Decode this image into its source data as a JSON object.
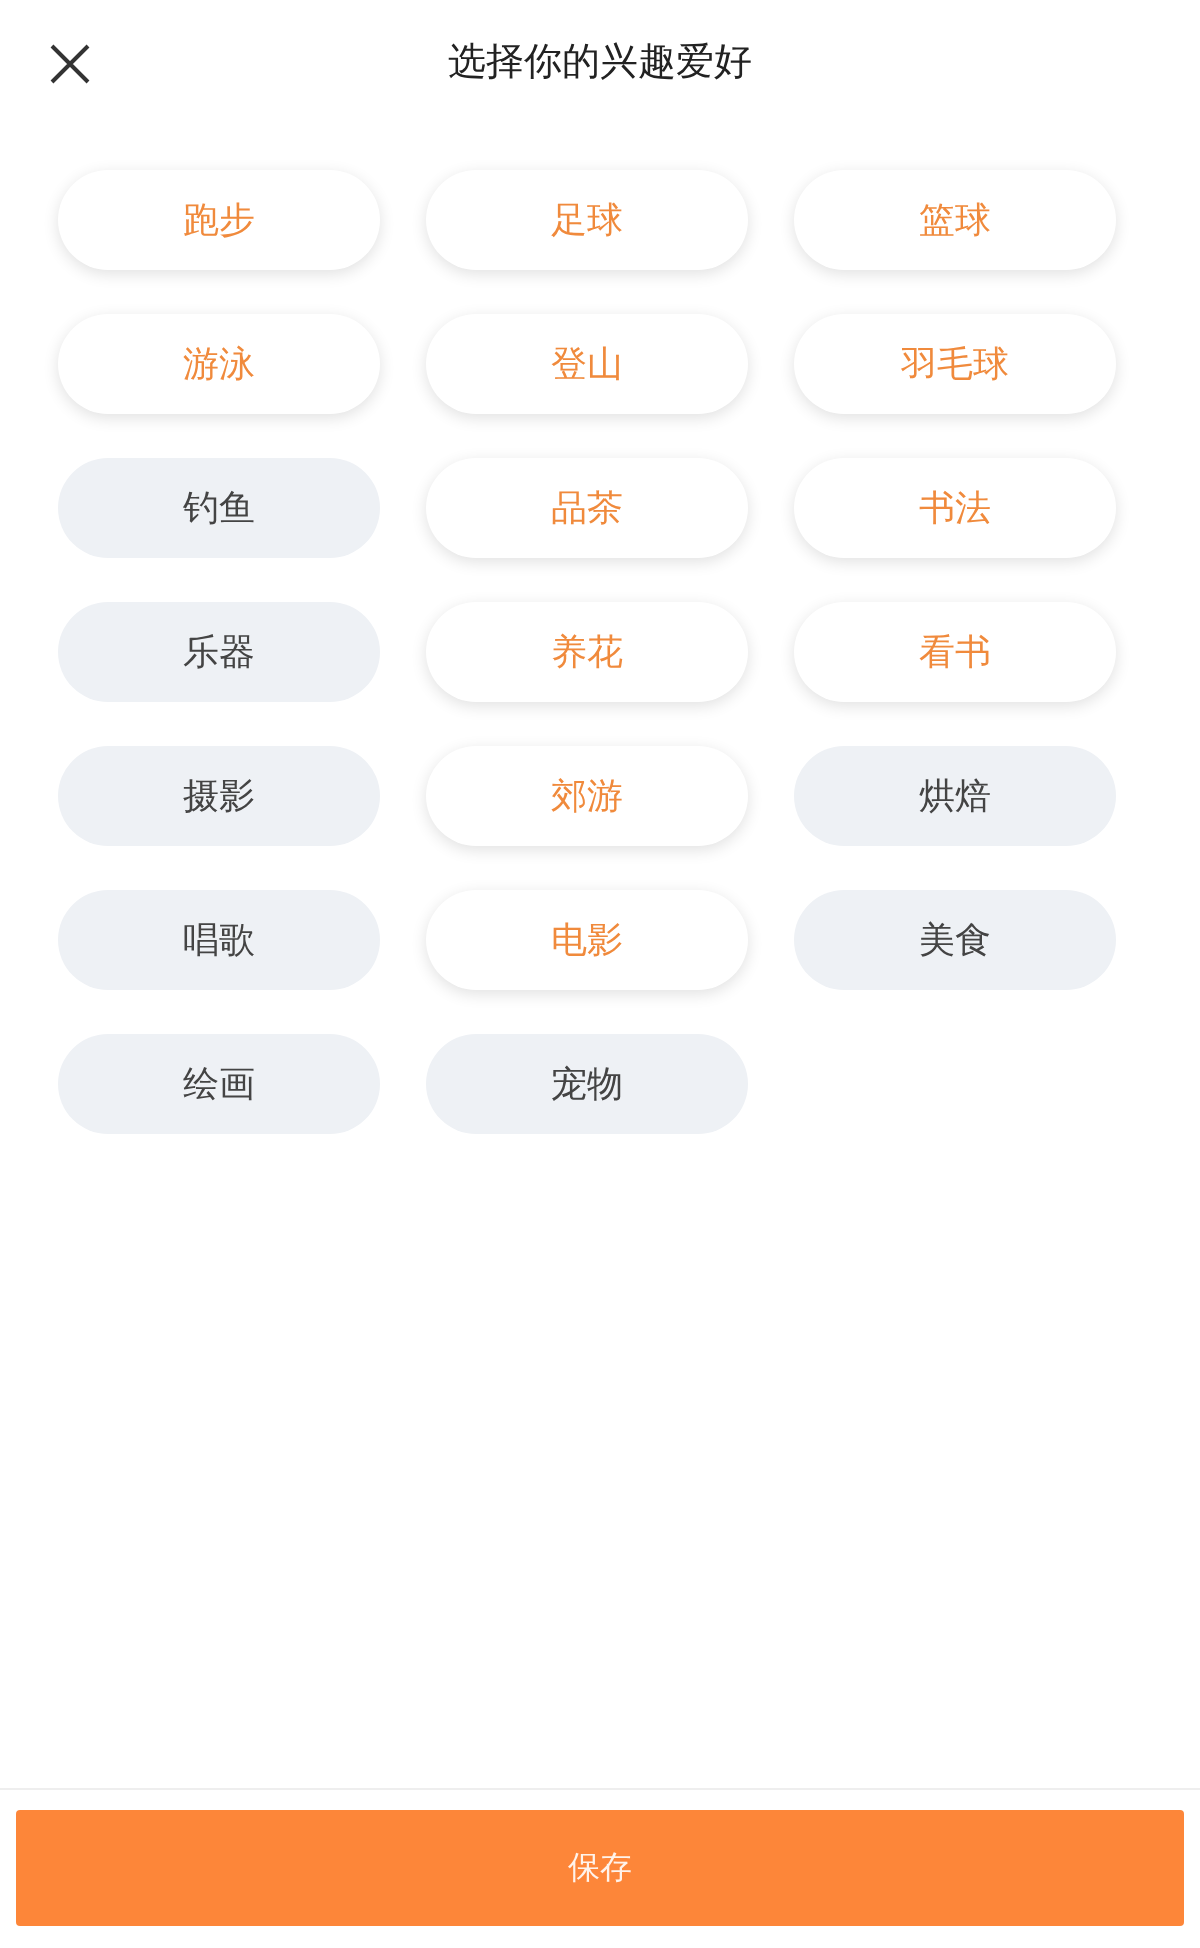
{
  "header": {
    "title": "选择你的兴趣爱好"
  },
  "interests": [
    {
      "label": "跑步",
      "selected": true
    },
    {
      "label": "足球",
      "selected": true
    },
    {
      "label": "篮球",
      "selected": true
    },
    {
      "label": "游泳",
      "selected": true
    },
    {
      "label": "登山",
      "selected": true
    },
    {
      "label": "羽毛球",
      "selected": true
    },
    {
      "label": "钓鱼",
      "selected": false
    },
    {
      "label": "品茶",
      "selected": true
    },
    {
      "label": "书法",
      "selected": true
    },
    {
      "label": "乐器",
      "selected": false
    },
    {
      "label": "养花",
      "selected": true
    },
    {
      "label": "看书",
      "selected": true
    },
    {
      "label": "摄影",
      "selected": false
    },
    {
      "label": "郊游",
      "selected": true
    },
    {
      "label": "烘焙",
      "selected": false
    },
    {
      "label": "唱歌",
      "selected": false
    },
    {
      "label": "电影",
      "selected": true
    },
    {
      "label": "美食",
      "selected": false
    },
    {
      "label": "绘画",
      "selected": false
    },
    {
      "label": "宠物",
      "selected": false
    }
  ],
  "save_button": {
    "label": "保存"
  }
}
